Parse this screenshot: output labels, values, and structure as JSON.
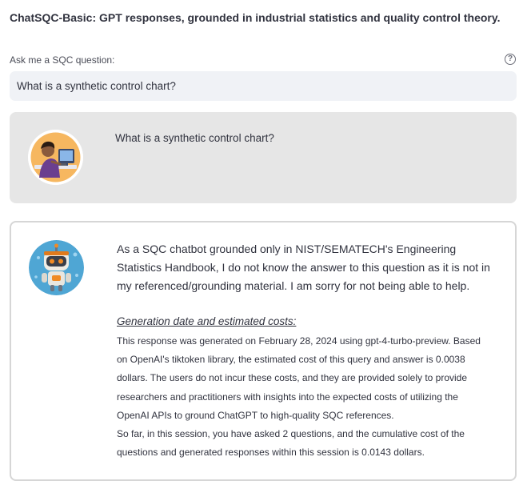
{
  "header": {
    "title": "ChatSQC-Basic: GPT responses, grounded in industrial statistics and quality control theory."
  },
  "question_input": {
    "label": "Ask me a SQC question:",
    "value": "What is a synthetic control chart?",
    "help_icon": "question-circle-icon"
  },
  "user_message": {
    "avatar": "user-at-computer-avatar",
    "text": "What is a synthetic control chart?"
  },
  "bot_message": {
    "avatar": "robot-avatar",
    "answer": "As a SQC chatbot grounded only in NIST/SEMATECH's Engineering Statistics Handbook, I do not know the answer to this question as it is not in my referenced/grounding material. I am sorry for not being able to help.",
    "generation_heading": "Generation date and estimated costs:",
    "cost_paragraph": "This response was generated on February 28, 2024 using gpt-4-turbo-preview. Based on OpenAI's tiktoken library, the estimated cost of this query and answer is 0.0038 dollars. The users do not incur these costs, and they are provided solely to provide researchers and practitioners with insights into the expected costs of utilizing the OpenAI APIs to ground ChatGPT to high-quality SQC references.",
    "session_paragraph": "So far, in this session, you have asked 2 questions, and the cumulative cost of the questions and generated responses within this session is 0.0143 dollars."
  },
  "colors": {
    "user_bubble": "#e6e6e6",
    "input_bg": "#f0f2f6",
    "text": "#31333f",
    "bot_border": "#d6d6d6",
    "user_avatar_bg": "#f6b760",
    "bot_avatar_bg": "#4fa6d4"
  }
}
